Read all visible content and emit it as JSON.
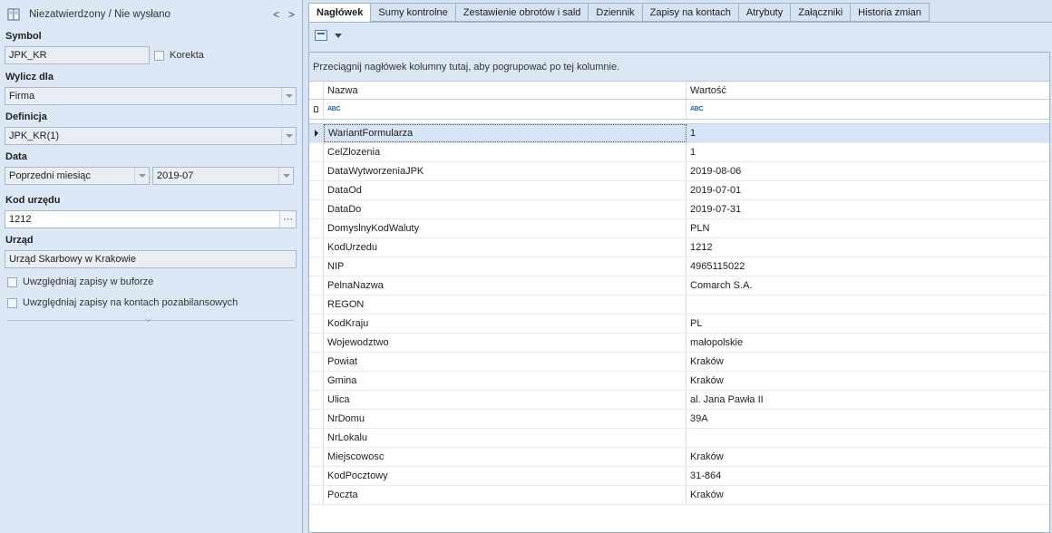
{
  "left_panel": {
    "status": "Niezatwierdzony / Nie wysłano",
    "nav_prev": "<",
    "nav_next": ">",
    "symbol": {
      "label": "Symbol",
      "value": "JPK_KR",
      "korekta_label": "Korekta"
    },
    "wylicz_dla": {
      "label": "Wylicz dla",
      "value": "Firma"
    },
    "definicja": {
      "label": "Definicja",
      "value": "JPK_KR(1)"
    },
    "data": {
      "label": "Data",
      "period": "Poprzedni miesiąc",
      "month": "2019-07"
    },
    "kod_urzedu": {
      "label": "Kod urzędu",
      "value": "1212",
      "dots": "···"
    },
    "urzad": {
      "label": "Urząd",
      "value": "Urząd Skarbowy w Krakowie"
    },
    "checkbox_buffer": "Uwzględniaj zapisy w buforze",
    "checkbox_offbalance": "Uwzględniaj zapisy na kontach pozabilansowych",
    "collapse_glyph": "⌵"
  },
  "tabs": [
    {
      "label": "Nagłówek",
      "active": true
    },
    {
      "label": "Sumy kontrolne"
    },
    {
      "label": "Zestawienie obrotów i sald"
    },
    {
      "label": "Dziennik"
    },
    {
      "label": "Zapisy na kontach"
    },
    {
      "label": "Atrybuty"
    },
    {
      "label": "Załączniki"
    },
    {
      "label": "Historia zmian"
    }
  ],
  "grid": {
    "group_hint": "Przeciągnij nagłówek kolumny tutaj, aby pogrupować po tej kolumnie.",
    "columns": {
      "name": "Nazwa",
      "value": "Wartość"
    },
    "filter_glyph": "ABC",
    "rows": [
      {
        "name": "WariantFormularza",
        "value": "1"
      },
      {
        "name": "CelZlozenia",
        "value": "1"
      },
      {
        "name": "DataWytworzeniaJPK",
        "value": "2019-08-06"
      },
      {
        "name": "DataOd",
        "value": "2019-07-01"
      },
      {
        "name": "DataDo",
        "value": "2019-07-31"
      },
      {
        "name": "DomyslnyKodWaluty",
        "value": "PLN"
      },
      {
        "name": "KodUrzedu",
        "value": "1212"
      },
      {
        "name": "NIP",
        "value": "4965115022"
      },
      {
        "name": "PelnaNazwa",
        "value": "Comarch S.A."
      },
      {
        "name": "REGON",
        "value": ""
      },
      {
        "name": "KodKraju",
        "value": "PL"
      },
      {
        "name": "Wojewodztwo",
        "value": "małopolskie"
      },
      {
        "name": "Powiat",
        "value": "Kraków"
      },
      {
        "name": "Gmina",
        "value": "Kraków"
      },
      {
        "name": "Ulica",
        "value": "al. Jana Pawła II"
      },
      {
        "name": "NrDomu",
        "value": "39A"
      },
      {
        "name": "NrLokalu",
        "value": ""
      },
      {
        "name": "Miejscowosc",
        "value": "Kraków"
      },
      {
        "name": "KodPocztowy",
        "value": "31-864"
      },
      {
        "name": "Poczta",
        "value": "Kraków"
      }
    ]
  }
}
